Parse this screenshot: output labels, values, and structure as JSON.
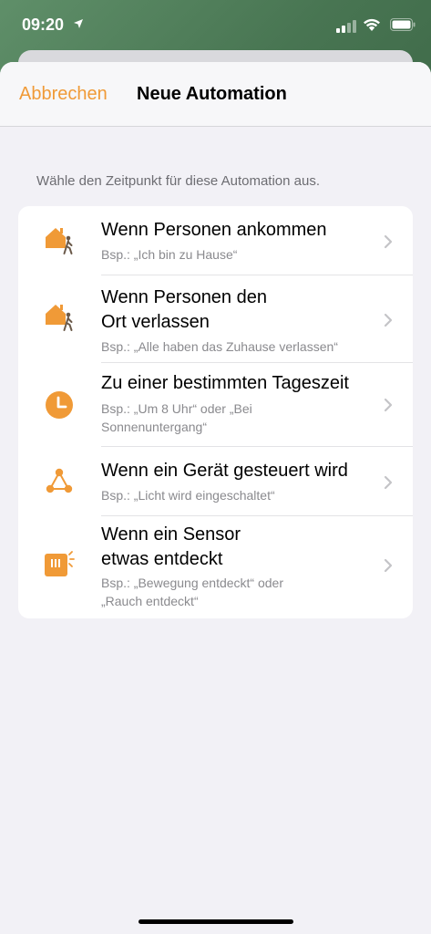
{
  "status_bar": {
    "time": "09:20"
  },
  "nav": {
    "cancel_label": "Abbrechen",
    "title": "Neue Automation"
  },
  "section_header": "Wähle den Zeitpunkt für diese Automation aus.",
  "options": [
    {
      "title": "Wenn Personen ankommen",
      "subtitle": "Bsp.: „Ich bin zu Hause“",
      "icon": "house-person-arrive-icon"
    },
    {
      "title_line1": "Wenn Personen den",
      "title_line2": "Ort verlassen",
      "subtitle": "Bsp.: „Alle haben das Zuhause verlassen“",
      "icon": "house-person-leave-icon"
    },
    {
      "title": "Zu einer bestimmten Tageszeit",
      "subtitle_line1": "Bsp.: „Um 8 Uhr“ oder „Bei",
      "subtitle_line2": "Sonnenuntergang“",
      "icon": "clock-icon"
    },
    {
      "title": "Wenn ein Gerät gesteuert wird",
      "subtitle": "Bsp.: „Licht wird eingeschaltet“",
      "icon": "device-network-icon"
    },
    {
      "title_line1": "Wenn ein Sensor",
      "title_line2": "etwas entdeckt",
      "subtitle_line1": "Bsp.: „Bewegung entdeckt“ oder",
      "subtitle_line2": "„Rauch entdeckt“",
      "icon": "sensor-icon"
    }
  ],
  "colors": {
    "accent": "#f09a37",
    "background": "#f2f1f6",
    "card": "#ffffff"
  }
}
